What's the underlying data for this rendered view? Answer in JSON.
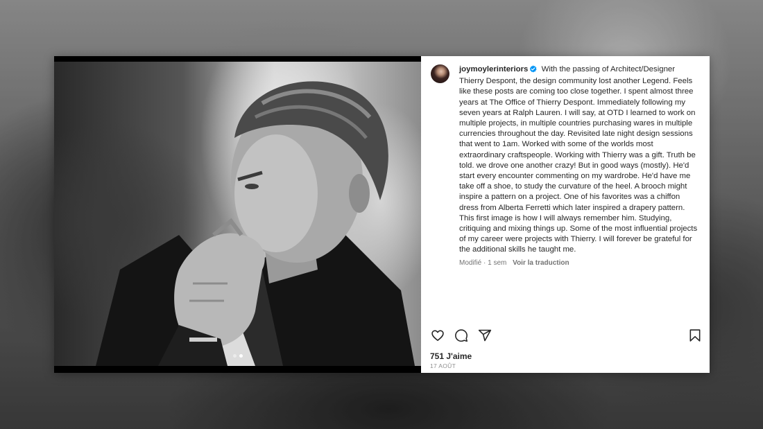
{
  "post": {
    "username": "joymoylerinteriors",
    "caption": "With the passing of Architect/Designer Thierry Despont, the design community lost another Legend. Feels like these posts are coming too close together. I spent almost three years at The Office of Thierry Despont. Immediately following my seven years at Ralph Lauren. I will say, at OTD I learned to work on multiple projects, in multiple countries purchasing wares in multiple currencies throughout the day. Revisited late night design sessions that went to 1am. Worked with some of the worlds most extraordinary craftspeople. Working with Thierry was a gift. Truth be told. we drove one another crazy! But in good ways (mostly). He'd start every encounter commenting on my wardrobe. He'd have me take off a shoe, to study the curvature of the heel. A brooch might inspire a pattern on a project. One of his favorites was a chiffon dress from Alberta Ferretti which later inspired a drapery pattern. This first image is how I will always remember him. Studying, critiquing and mixing things up. Some of the most influential projects of my career were projects with Thierry. I will forever be grateful for the additional skills he taught me.",
    "edited_label": "Modifié · 1 sem",
    "translate_label": "Voir la traduction",
    "likes": "751 J'aime",
    "date": "17 AOÛT"
  },
  "carousel": {
    "total": 2,
    "current": 2
  },
  "icons": {
    "verified": "verified-badge-icon",
    "like": "heart-icon",
    "comment": "comment-icon",
    "share": "share-icon",
    "save": "bookmark-icon"
  },
  "colors": {
    "verified_blue": "#0095f6",
    "text": "#262626",
    "muted": "#737373"
  }
}
